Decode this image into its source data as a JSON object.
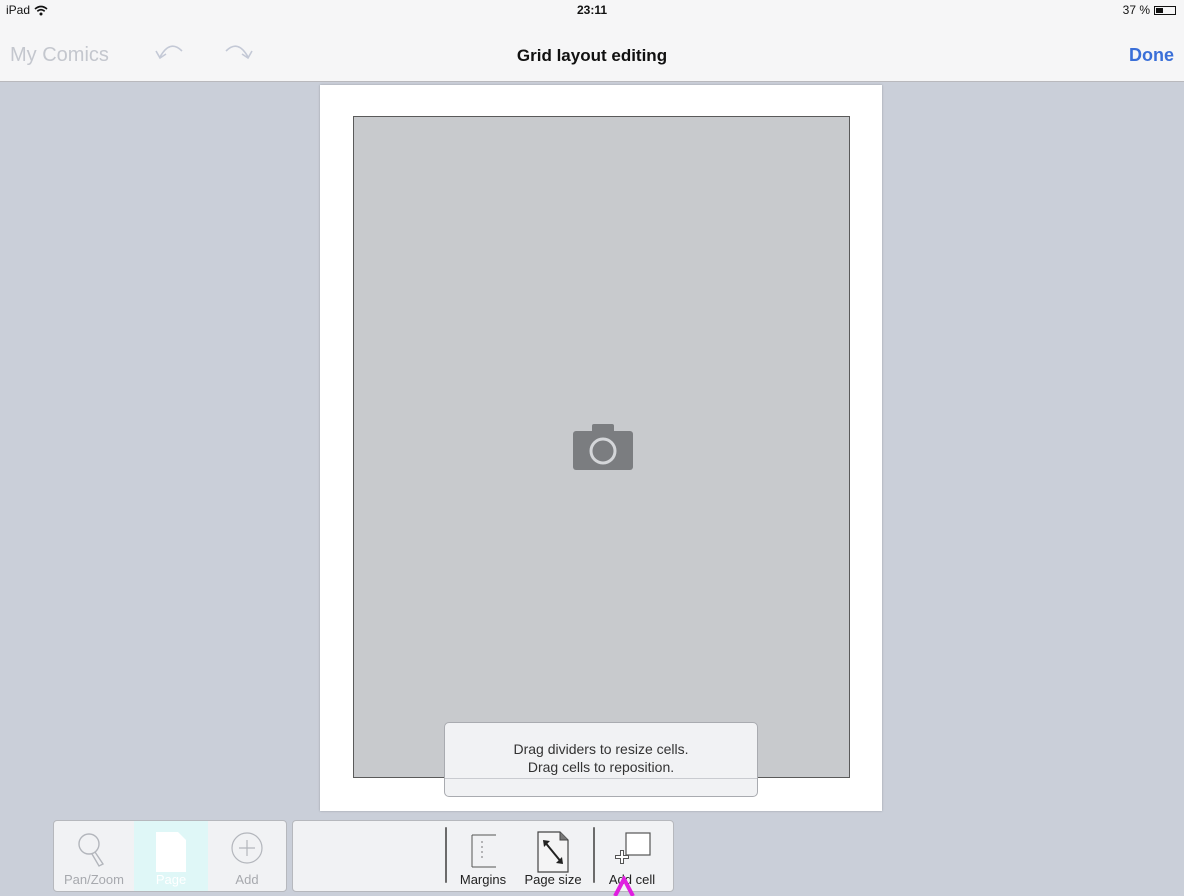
{
  "statusbar": {
    "device": "iPad",
    "time": "23:11",
    "battery_text": "37 %",
    "battery_level": 0.37
  },
  "nav": {
    "back_label": "My Comics",
    "title": "Grid layout editing",
    "done_label": "Done",
    "icons": [
      "undo-icon",
      "redo-icon"
    ]
  },
  "hint": {
    "line1": "Drag dividers to resize cells.",
    "line2": "Drag cells to reposition."
  },
  "toolbar_left": {
    "items": [
      {
        "label": "Pan/Zoom",
        "icon": "magnifier-icon",
        "active": false
      },
      {
        "label": "Page",
        "icon": "page-icon",
        "active": true
      },
      {
        "label": "Add",
        "icon": "plus-circle-icon",
        "active": false
      }
    ]
  },
  "toolbar_right": {
    "items": [
      {
        "label": "Margins",
        "icon": "margins-icon"
      },
      {
        "label": "Page size",
        "icon": "page-size-icon"
      },
      {
        "label": "Add cell",
        "icon": "add-cell-icon"
      }
    ]
  },
  "colors": {
    "accent": "#3a6fd8",
    "background": "#cacfd9",
    "highlight": "#dff7f7",
    "pointer": "#e01ee0"
  }
}
